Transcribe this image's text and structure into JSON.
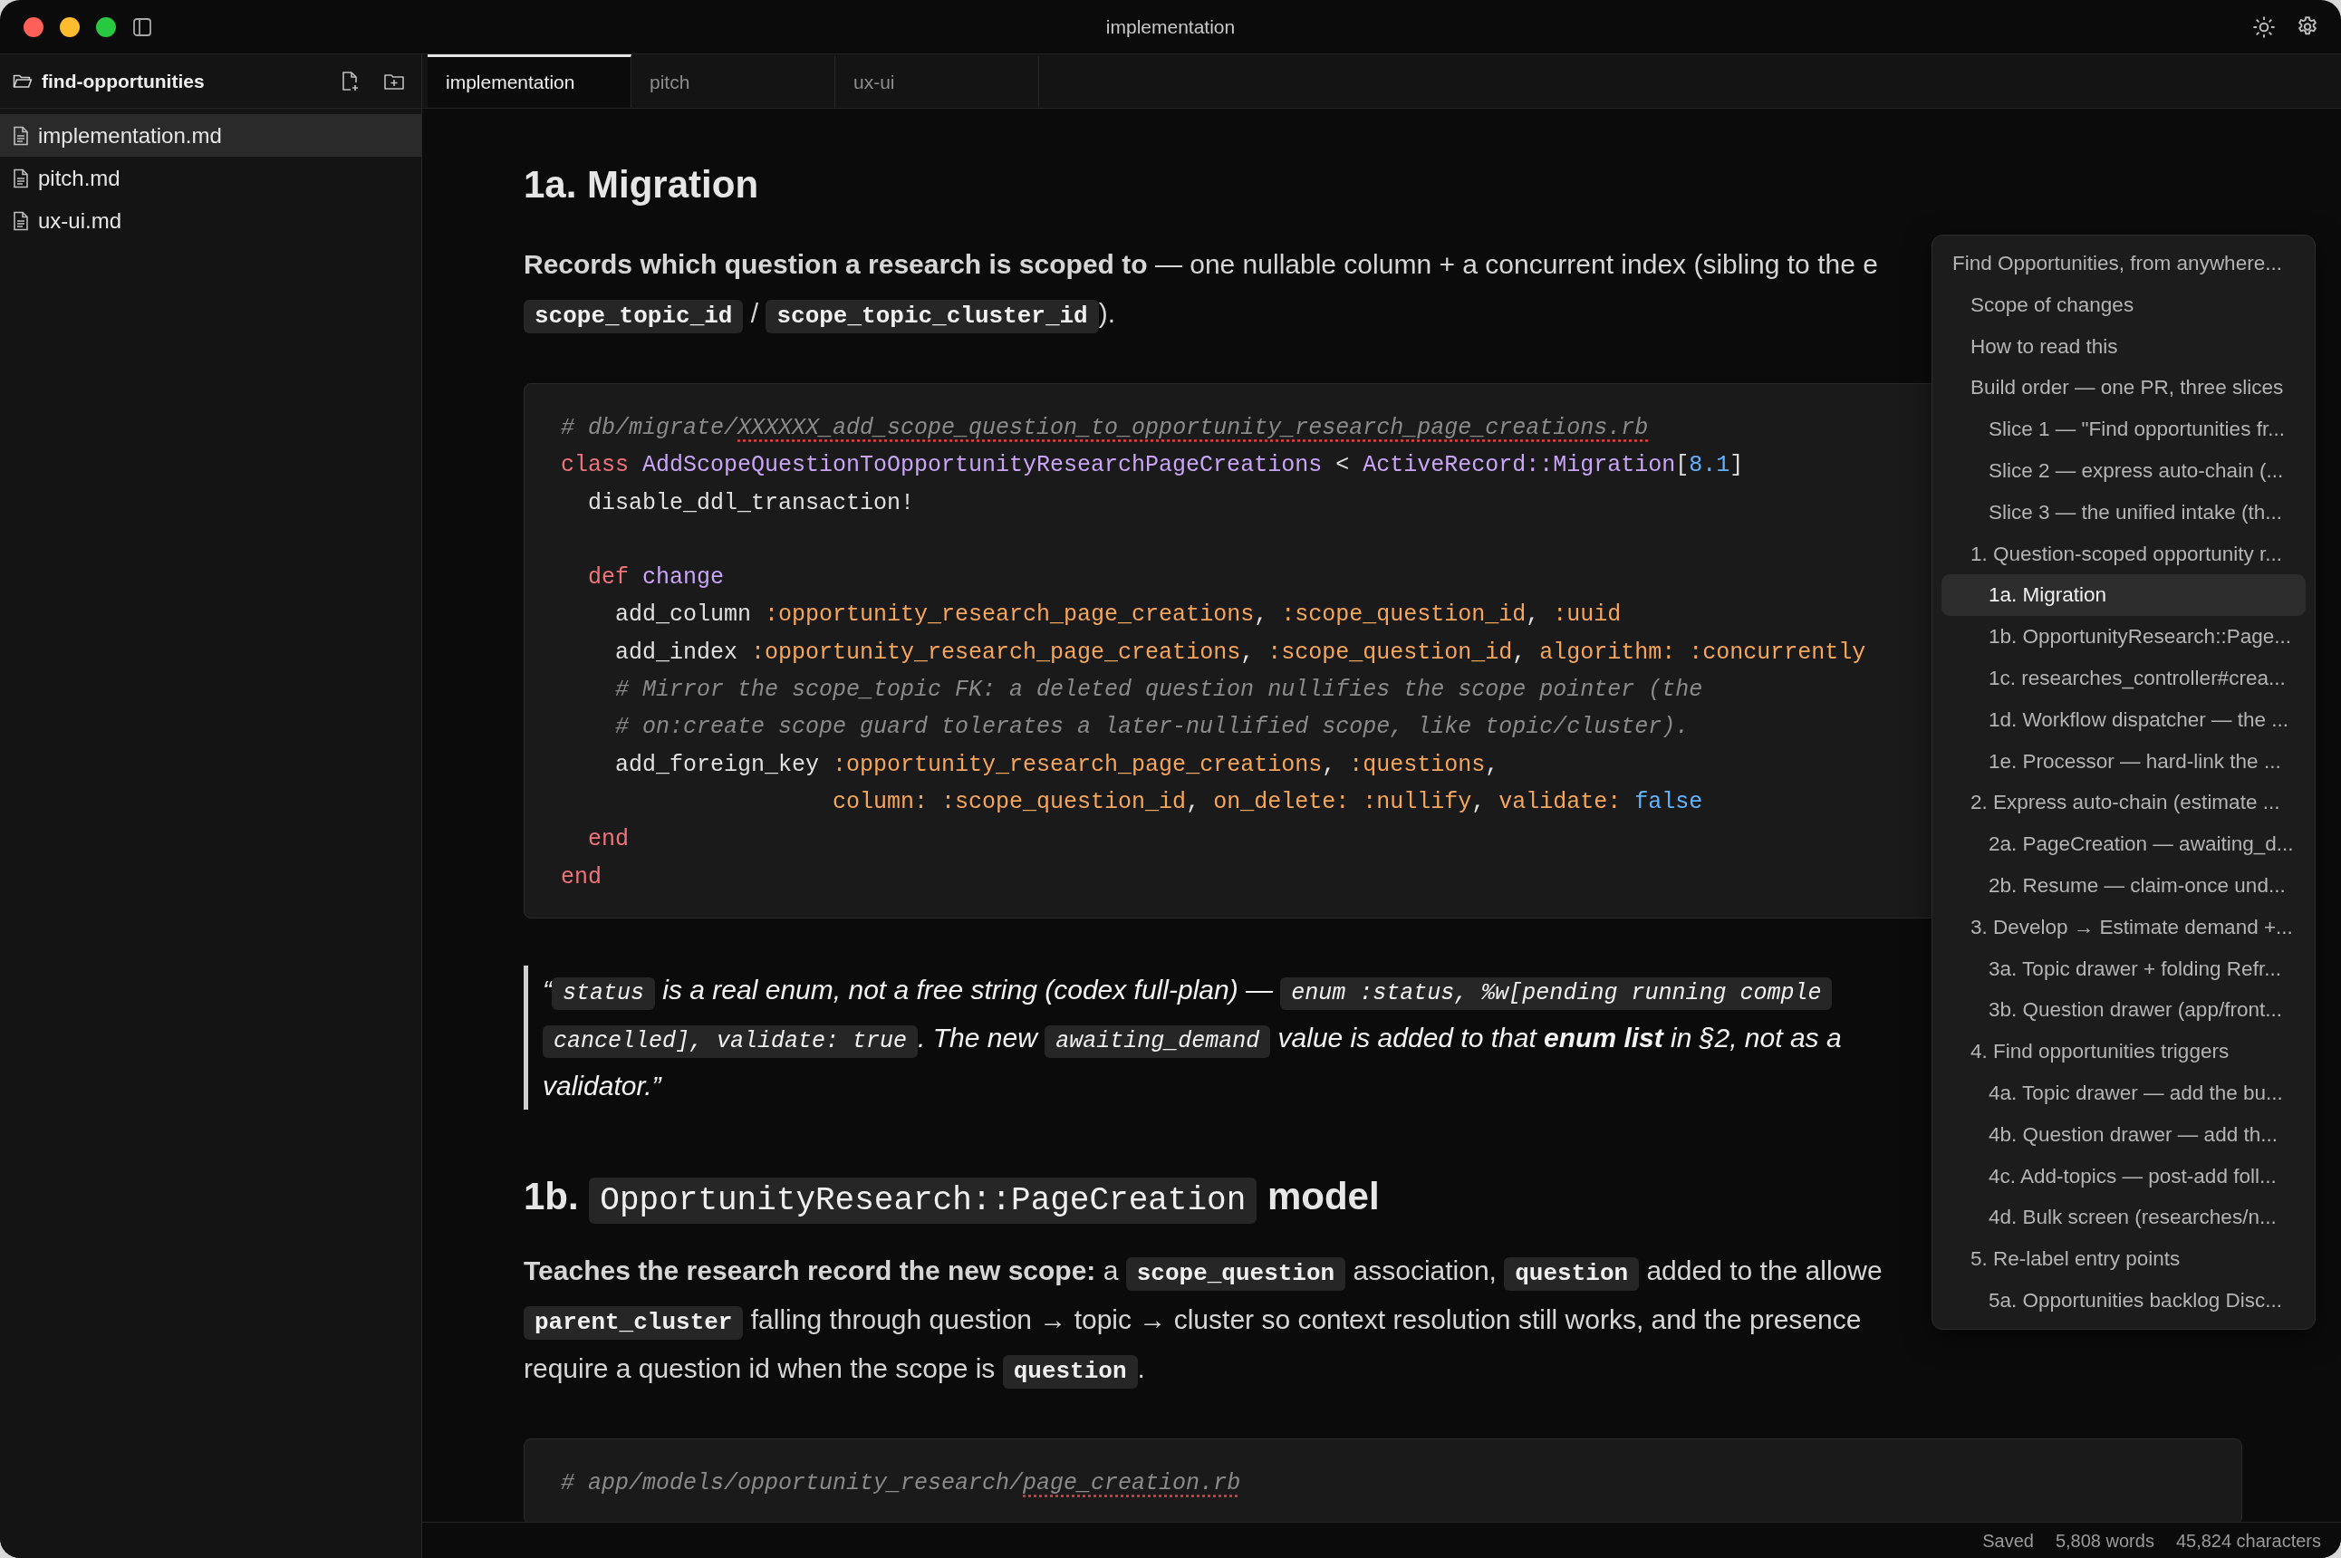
{
  "window": {
    "title": "implementation"
  },
  "sidebar": {
    "folder": "find-opportunities",
    "files": [
      {
        "name": "implementation.md",
        "selected": true
      },
      {
        "name": "pitch.md",
        "selected": false
      },
      {
        "name": "ux-ui.md",
        "selected": false
      }
    ]
  },
  "tabs": [
    {
      "label": "implementation",
      "selected": true
    },
    {
      "label": "pitch",
      "selected": false
    },
    {
      "label": "ux-ui",
      "selected": false
    }
  ],
  "document": {
    "blocks": [
      {
        "kind": "h1",
        "lines": [
          [
            {
              "kind": "text",
              "text": "1a. Migration"
            }
          ]
        ]
      },
      {
        "kind": "paragraph",
        "lines": [
          [
            {
              "kind": "text",
              "text": "**Records which question a research is scoped to** — one nullable column + a concurrent index (sibling to the e"
            }
          ],
          [
            {
              "kind": "code",
              "text": "scope_topic_id"
            },
            {
              "kind": "text",
              "text": " / "
            },
            {
              "kind": "code",
              "text": "scope_topic_cluster_id"
            },
            {
              "kind": "text",
              "text": ")."
            }
          ]
        ]
      },
      {
        "kind": "codeblock",
        "lines": [
          {
            "kind": "code",
            "tokens": [
              {
                "kind": "comment",
                "text": "# db/migrate/"
              },
              {
                "kind": "flagged",
                "text": "XXXXXX_add_scope_question_to_opportunity_research_page_creations.rb"
              }
            ]
          },
          {
            "kind": "code",
            "tokens": [
              {
                "kind": "keyword",
                "text": "class"
              },
              {
                "kind": "class",
                "text": " AddScopeQuestionToOpportunityResearchPageCreations"
              },
              {
                "kind": "plain",
                "text": " < "
              },
              {
                "kind": "class",
                "text": "ActiveRecord::Migration"
              },
              {
                "kind": "plain",
                "text": "["
              },
              {
                "kind": "number",
                "text": "8.1"
              },
              {
                "kind": "plain",
                "text": "]"
              }
            ]
          },
          {
            "kind": "code",
            "tokens": [
              {
                "kind": "plain",
                "text": "  disable_ddl_transaction!"
              }
            ]
          },
          {
            "kind": "blank"
          },
          {
            "kind": "code",
            "tokens": [
              {
                "kind": "keyword",
                "text": "  def"
              },
              {
                "kind": "class",
                "text": " change"
              }
            ]
          },
          {
            "kind": "code",
            "tokens": [
              {
                "kind": "plain",
                "text": "    add_column "
              },
              {
                "kind": "symbol",
                "text": ":opportunity_research_page_creations"
              },
              {
                "kind": "plain",
                "text": ", "
              },
              {
                "kind": "symbol",
                "text": ":scope_question_id"
              },
              {
                "kind": "plain",
                "text": ", "
              },
              {
                "kind": "symbol",
                "text": ":uuid"
              }
            ]
          },
          {
            "kind": "code",
            "tokens": [
              {
                "kind": "plain",
                "text": "    add_index "
              },
              {
                "kind": "symbol",
                "text": ":opportunity_research_page_creations"
              },
              {
                "kind": "plain",
                "text": ", "
              },
              {
                "kind": "symbol",
                "text": ":scope_question_id"
              },
              {
                "kind": "plain",
                "text": ", "
              },
              {
                "kind": "symbol",
                "text": "algorithm: :concurrently"
              }
            ]
          },
          {
            "kind": "code",
            "tokens": [
              {
                "kind": "comment",
                "text": "    # Mirror the scope_topic FK: a deleted question nullifies the scope pointer (the"
              }
            ]
          },
          {
            "kind": "code",
            "tokens": [
              {
                "kind": "comment",
                "text": "    # on:create scope guard tolerates a later-nullified scope, like topic/cluster)."
              }
            ]
          },
          {
            "kind": "code",
            "tokens": [
              {
                "kind": "plain",
                "text": "    add_foreign_key "
              },
              {
                "kind": "symbol",
                "text": ":opportunity_research_page_creations"
              },
              {
                "kind": "plain",
                "text": ", "
              },
              {
                "kind": "symbol",
                "text": ":questions"
              },
              {
                "kind": "plain",
                "text": ","
              }
            ]
          },
          {
            "kind": "code",
            "tokens": [
              {
                "kind": "symbol",
                "text": "                    column: :scope_question_id"
              },
              {
                "kind": "plain",
                "text": ", "
              },
              {
                "kind": "symbol",
                "text": "on_delete: :nullify"
              },
              {
                "kind": "plain",
                "text": ", "
              },
              {
                "kind": "symbol",
                "text": "validate:"
              },
              {
                "kind": "bool",
                "text": " false"
              }
            ]
          },
          {
            "kind": "code",
            "tokens": [
              {
                "kind": "keyword",
                "text": "  end"
              }
            ]
          },
          {
            "kind": "code",
            "tokens": [
              {
                "kind": "keyword",
                "text": "end"
              }
            ]
          }
        ]
      },
      {
        "kind": "blockquote",
        "lines": [
          [
            {
              "kind": "text",
              "text": "“"
            },
            {
              "kind": "code",
              "text": "status"
            },
            {
              "kind": "text",
              "text": " is a real enum, not a free string (codex full-plan) — "
            },
            {
              "kind": "code",
              "text": "enum :status, %w[pending running comple"
            }
          ],
          [
            {
              "kind": "code",
              "text": "cancelled], validate: true"
            },
            {
              "kind": "text",
              "text": ". The new "
            },
            {
              "kind": "code",
              "text": "awaiting_demand"
            },
            {
              "kind": "text",
              "text": " value is added to that **enum list** in §2, not as a"
            }
          ],
          [
            {
              "kind": "text",
              "text": "validator.”"
            }
          ]
        ]
      },
      {
        "kind": "h2",
        "lines": [
          [
            {
              "kind": "text",
              "text": "1b. "
            },
            {
              "kind": "code",
              "text": "OpportunityResearch::PageCreation"
            },
            {
              "kind": "text",
              "text": " model"
            }
          ]
        ]
      },
      {
        "kind": "paragraph",
        "lines": [
          [
            {
              "kind": "text",
              "text": "**Teaches the research record the new scope:** a "
            },
            {
              "kind": "code",
              "text": "scope_question"
            },
            {
              "kind": "text",
              "text": " association, "
            },
            {
              "kind": "code",
              "text": "question"
            },
            {
              "kind": "text",
              "text": " added to the allowe"
            }
          ],
          [
            {
              "kind": "code",
              "text": "parent_cluster"
            },
            {
              "kind": "text",
              "text": " falling through question → topic → cluster so context resolution still works, and the presence"
            }
          ],
          [
            {
              "kind": "text",
              "text": "require a question id when the scope is "
            },
            {
              "kind": "code",
              "text": "question"
            },
            {
              "kind": "text",
              "text": "."
            }
          ]
        ]
      },
      {
        "kind": "codeblock",
        "lines": [
          {
            "kind": "code",
            "tokens": [
              {
                "kind": "comment",
                "text": "# app/models/opportunity_research/"
              },
              {
                "kind": "flagged",
                "text": "page_creation.rb"
              }
            ]
          }
        ]
      }
    ]
  },
  "outline": [
    {
      "label": "Find Opportunities, from anywhere...",
      "selected": false,
      "children": [
        {
          "label": "Scope of changes",
          "selected": false
        },
        {
          "label": "How to read this",
          "selected": false
        },
        {
          "label": "Build order — one PR, three slices",
          "selected": false,
          "children": [
            {
              "label": "Slice 1 — \"Find opportunities fr...",
              "selected": false
            },
            {
              "label": "Slice 2 — express auto-chain (...",
              "selected": false
            },
            {
              "label": "Slice 3 — the unified intake (th...",
              "selected": false
            }
          ]
        },
        {
          "label": "1. Question-scoped opportunity r...",
          "selected": false,
          "children": [
            {
              "label": "1a. Migration",
              "selected": true
            },
            {
              "label": "1b. OpportunityResearch::Page...",
              "selected": false
            },
            {
              "label": "1c. researches_controller#crea...",
              "selected": false
            },
            {
              "label": "1d. Workflow dispatcher — the ...",
              "selected": false
            },
            {
              "label": "1e. Processor — hard-link the ...",
              "selected": false
            }
          ]
        },
        {
          "label": "2. Express auto-chain (estimate ...",
          "selected": false,
          "children": [
            {
              "label": "2a. PageCreation — awaiting_d...",
              "selected": false
            },
            {
              "label": "2b. Resume — claim-once und...",
              "selected": false
            }
          ]
        },
        {
          "label": "3. Develop → Estimate demand +...",
          "selected": false,
          "children": [
            {
              "label": "3a. Topic drawer + folding Refr...",
              "selected": false
            },
            {
              "label": "3b. Question drawer (app/front...",
              "selected": false
            }
          ]
        },
        {
          "label": "4. Find opportunities triggers",
          "selected": false,
          "children": [
            {
              "label": "4a. Topic drawer — add the bu...",
              "selected": false
            },
            {
              "label": "4b. Question drawer — add th...",
              "selected": false
            },
            {
              "label": "4c. Add-topics — post-add foll...",
              "selected": false
            },
            {
              "label": "4d. Bulk screen (researches/n...",
              "selected": false
            }
          ]
        },
        {
          "label": "5. Re-label entry points",
          "selected": false,
          "children": [
            {
              "label": "5a. Opportunities backlog Disc...",
              "selected": false
            }
          ]
        }
      ]
    }
  ],
  "status_bar": [
    "Saved",
    "5,808 words",
    "45,824 characters"
  ]
}
